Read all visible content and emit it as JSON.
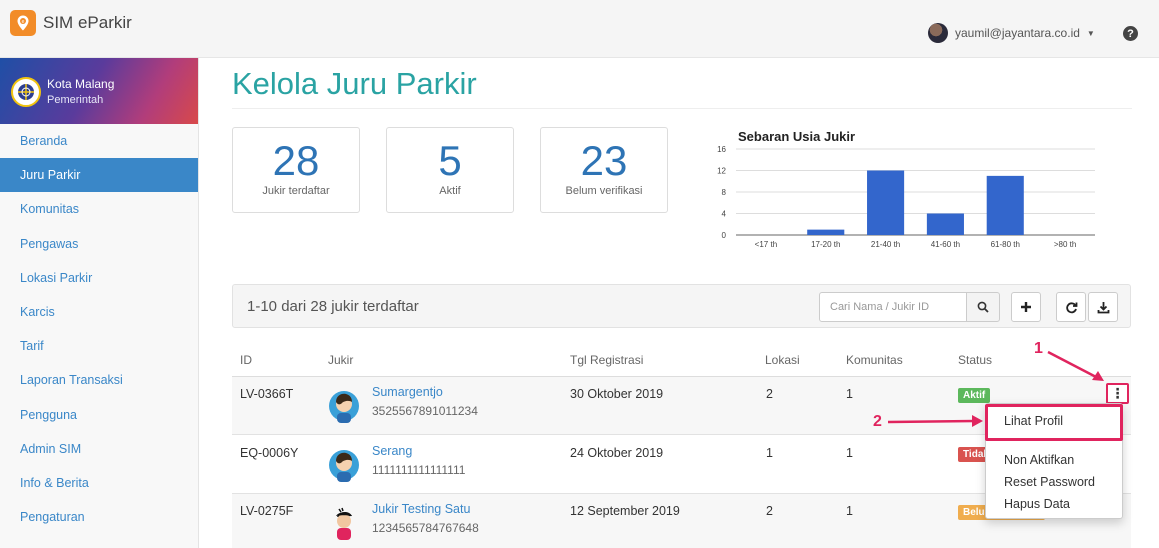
{
  "app": {
    "title": "SIM eParkir"
  },
  "user": {
    "email": "yaumil@jayantara.co.id"
  },
  "org": {
    "name": "Kota Malang",
    "type": "Pemerintah"
  },
  "sidebar": {
    "items": [
      {
        "label": "Beranda",
        "active": false
      },
      {
        "label": "Juru Parkir",
        "active": true
      },
      {
        "label": "Komunitas",
        "active": false
      },
      {
        "label": "Pengawas",
        "active": false
      },
      {
        "label": "Lokasi Parkir",
        "active": false
      },
      {
        "label": "Karcis",
        "active": false
      },
      {
        "label": "Tarif",
        "active": false
      },
      {
        "label": "Laporan Transaksi",
        "active": false
      },
      {
        "label": "Pengguna",
        "active": false
      },
      {
        "label": "Admin SIM",
        "active": false
      },
      {
        "label": "Info & Berita",
        "active": false
      },
      {
        "label": "Pengaturan",
        "active": false
      }
    ]
  },
  "page": {
    "title": "Kelola Juru Parkir"
  },
  "stats": [
    {
      "value": "28",
      "label": "Jukir terdaftar"
    },
    {
      "value": "5",
      "label": "Aktif"
    },
    {
      "value": "23",
      "label": "Belum verifikasi"
    }
  ],
  "chart_data": {
    "type": "bar",
    "title": "Sebaran Usia Jukir",
    "categories": [
      "<17 th",
      "17-20 th",
      "21-40 th",
      "41-60 th",
      "61-80 th",
      ">80 th"
    ],
    "values": [
      0,
      1,
      12,
      4,
      11,
      0
    ],
    "ylim": [
      0,
      16
    ],
    "yticks": [
      "0",
      "4",
      "8",
      "12",
      "16"
    ],
    "grid": true,
    "color": "#3366cc"
  },
  "panel": {
    "summary": "1-10 dari 28 jukir terdaftar",
    "search_placeholder": "Cari Nama / Jukir ID"
  },
  "table": {
    "headers": {
      "id": "ID",
      "jukir": "Jukir",
      "tgl": "Tgl Registrasi",
      "lokasi": "Lokasi",
      "komunitas": "Komunitas",
      "status": "Status"
    },
    "rows": [
      {
        "id": "LV-0366T",
        "name": "Sumargentjo",
        "nid": "3525567891011234",
        "tgl": "30 Oktober 2019",
        "lokasi": "2",
        "komunitas": "1",
        "status": "Aktif",
        "status_color": "#5cb85c"
      },
      {
        "id": "EQ-0006Y",
        "name": "Serang",
        "nid": "1111111111111111",
        "tgl": "24 Oktober 2019",
        "lokasi": "1",
        "komunitas": "1",
        "status": "Tidak Aktif",
        "status_color": "#d9534f"
      },
      {
        "id": "LV-0275F",
        "name": "Jukir Testing Satu",
        "nid": "1234565784767648",
        "tgl": "12 September 2019",
        "lokasi": "2",
        "komunitas": "1",
        "status": "Belum Verifikasi",
        "status_color": "#f0ad4e"
      }
    ]
  },
  "dropdown": {
    "items": [
      "Lihat Profil",
      "Non Aktifkan",
      "Reset Password",
      "Hapus Data"
    ]
  },
  "annotations": {
    "one": "1",
    "two": "2"
  },
  "icons": {
    "kebab": "⋮",
    "search": "search-icon",
    "plus": "+",
    "refresh": "refresh-icon",
    "download": "download-icon"
  }
}
